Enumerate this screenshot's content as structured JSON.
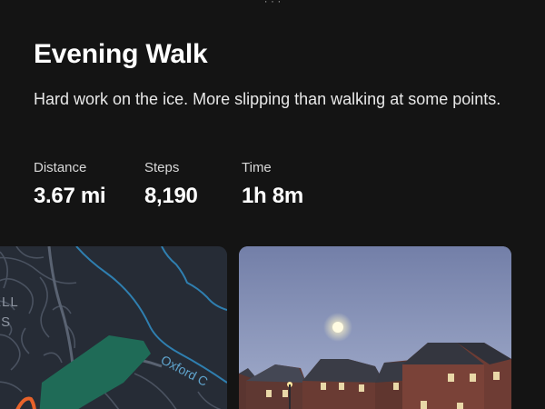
{
  "activity": {
    "title": "Evening Walk",
    "description": "Hard work on the ice. More slipping than walking at some points.",
    "stats": [
      {
        "label": "Distance",
        "value": "3.67 mi"
      },
      {
        "label": "Steps",
        "value": "8,190"
      },
      {
        "label": "Time",
        "value": "1h 8m"
      }
    ]
  },
  "map": {
    "place_label_line1": "ELL",
    "place_label_line2": "TS",
    "road_label": "Oxford C",
    "colors": {
      "background": "#262c36",
      "streets": "#4a5260",
      "water": "#2f7fb0",
      "park": "#1f6b57",
      "route": "#e8622a"
    }
  },
  "photo": {
    "subject": "houses-under-moon-photo",
    "colors": {
      "sky_top": "#737fa8",
      "sky_bottom": "#a7b1cc",
      "moon": "#fff6c8",
      "brick": "#6a3b33"
    }
  }
}
